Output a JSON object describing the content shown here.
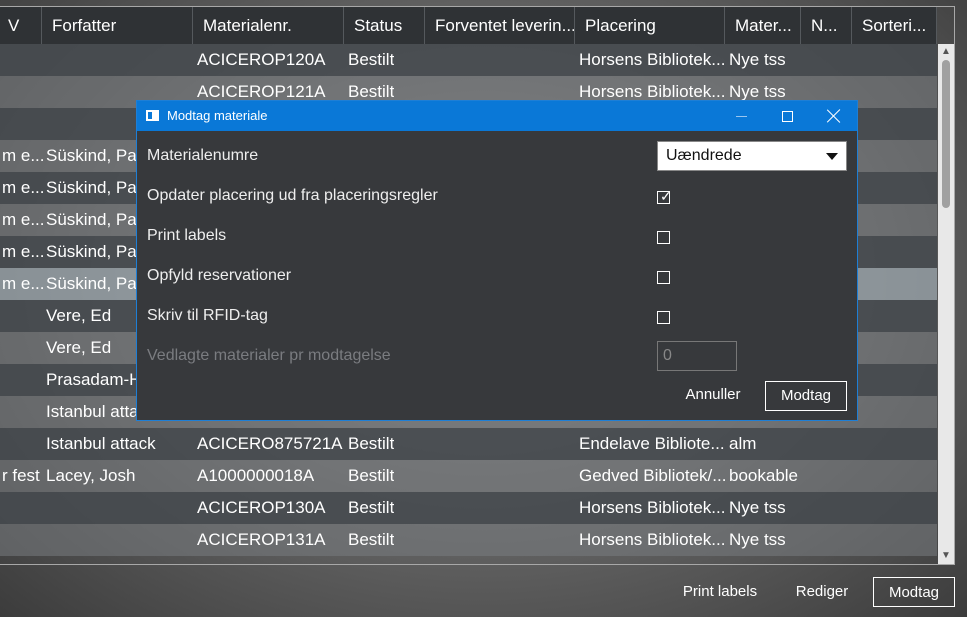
{
  "grid": {
    "columns": [
      {
        "label": "V"
      },
      {
        "label": "Forfatter"
      },
      {
        "label": "Materialenr."
      },
      {
        "label": "Status"
      },
      {
        "label": "Forventet leverin..."
      },
      {
        "label": "Placering"
      },
      {
        "label": "Mater..."
      },
      {
        "label": "N..."
      },
      {
        "label": "Sorteri..."
      }
    ],
    "rows": [
      {
        "title": "",
        "author": "",
        "material": "ACICEROP120A",
        "status": "Bestilt",
        "placement": "Horsens Bibliotek...",
        "mattype": "Nye tss"
      },
      {
        "title": "",
        "author": "",
        "material": "ACICEROP121A",
        "status": "Bestilt",
        "placement": "Horsens Bibliotek...",
        "mattype": "Nye tss"
      },
      {
        "title": "",
        "author": "",
        "material": "",
        "status": "",
        "placement": "",
        "mattype": ""
      },
      {
        "title": "m e...",
        "author": "Süskind, Patr",
        "material": "",
        "status": "",
        "placement": "",
        "mattype": ""
      },
      {
        "title": "m e...",
        "author": "Süskind, Patr",
        "material": "",
        "status": "",
        "placement": "",
        "mattype": ""
      },
      {
        "title": "m e...",
        "author": "Süskind, Patr",
        "material": "",
        "status": "",
        "placement": "",
        "mattype": ""
      },
      {
        "title": "m e...",
        "author": "Süskind, Patr",
        "material": "",
        "status": "",
        "placement": "",
        "mattype": ""
      },
      {
        "title": "m e...",
        "author": "Süskind, Patr",
        "material": "",
        "status": "",
        "placement": "",
        "mattype": ""
      },
      {
        "title": "",
        "author": "Vere, Ed",
        "material": "",
        "status": "",
        "placement": "",
        "mattype": ""
      },
      {
        "title": "",
        "author": "Vere, Ed",
        "material": "",
        "status": "",
        "placement": "",
        "mattype": ""
      },
      {
        "title": "",
        "author": "Prasadam-Ha",
        "material": "",
        "status": "",
        "placement": "",
        "mattype": ""
      },
      {
        "title": "",
        "author": "Istanbul atta",
        "material": "",
        "status": "",
        "placement": "",
        "mattype": ""
      },
      {
        "title": "",
        "author": "Istanbul attack",
        "material": "ACICERO875721A",
        "status": "Bestilt",
        "placement": "Endelave Bibliote...",
        "mattype": "alm"
      },
      {
        "title": "r fest",
        "author": "Lacey, Josh",
        "material": "A1000000018A",
        "status": "Bestilt",
        "placement": "Gedved Bibliotek/...",
        "mattype": "bookable"
      },
      {
        "title": "",
        "author": "",
        "material": "ACICEROP130A",
        "status": "Bestilt",
        "placement": "Horsens Bibliotek...",
        "mattype": "Nye tss"
      },
      {
        "title": "",
        "author": "",
        "material": "ACICEROP131A",
        "status": "Bestilt",
        "placement": "Horsens Bibliotek...",
        "mattype": "Nye tss"
      }
    ]
  },
  "bottom_bar": {
    "print_labels": "Print labels",
    "edit": "Rediger",
    "receive": "Modtag"
  },
  "dialog": {
    "title": "Modtag materiale",
    "material_numbers_label": "Materialenumre",
    "material_numbers_value": "Uændrede",
    "update_placement_label": "Opdater placering ud fra placeringsregler",
    "update_placement_checked": true,
    "print_labels_label": "Print labels",
    "print_labels_checked": false,
    "fulfill_reservations_label": "Opfyld reservationer",
    "fulfill_reservations_checked": false,
    "write_rfid_label": "Skriv til RFID-tag",
    "write_rfid_checked": false,
    "attached_materials_label": "Vedlagte materialer pr modtagelse",
    "attached_materials_value": "0",
    "cancel": "Annuller",
    "receive": "Modtag"
  },
  "icons": {
    "checkmark": "✓"
  }
}
